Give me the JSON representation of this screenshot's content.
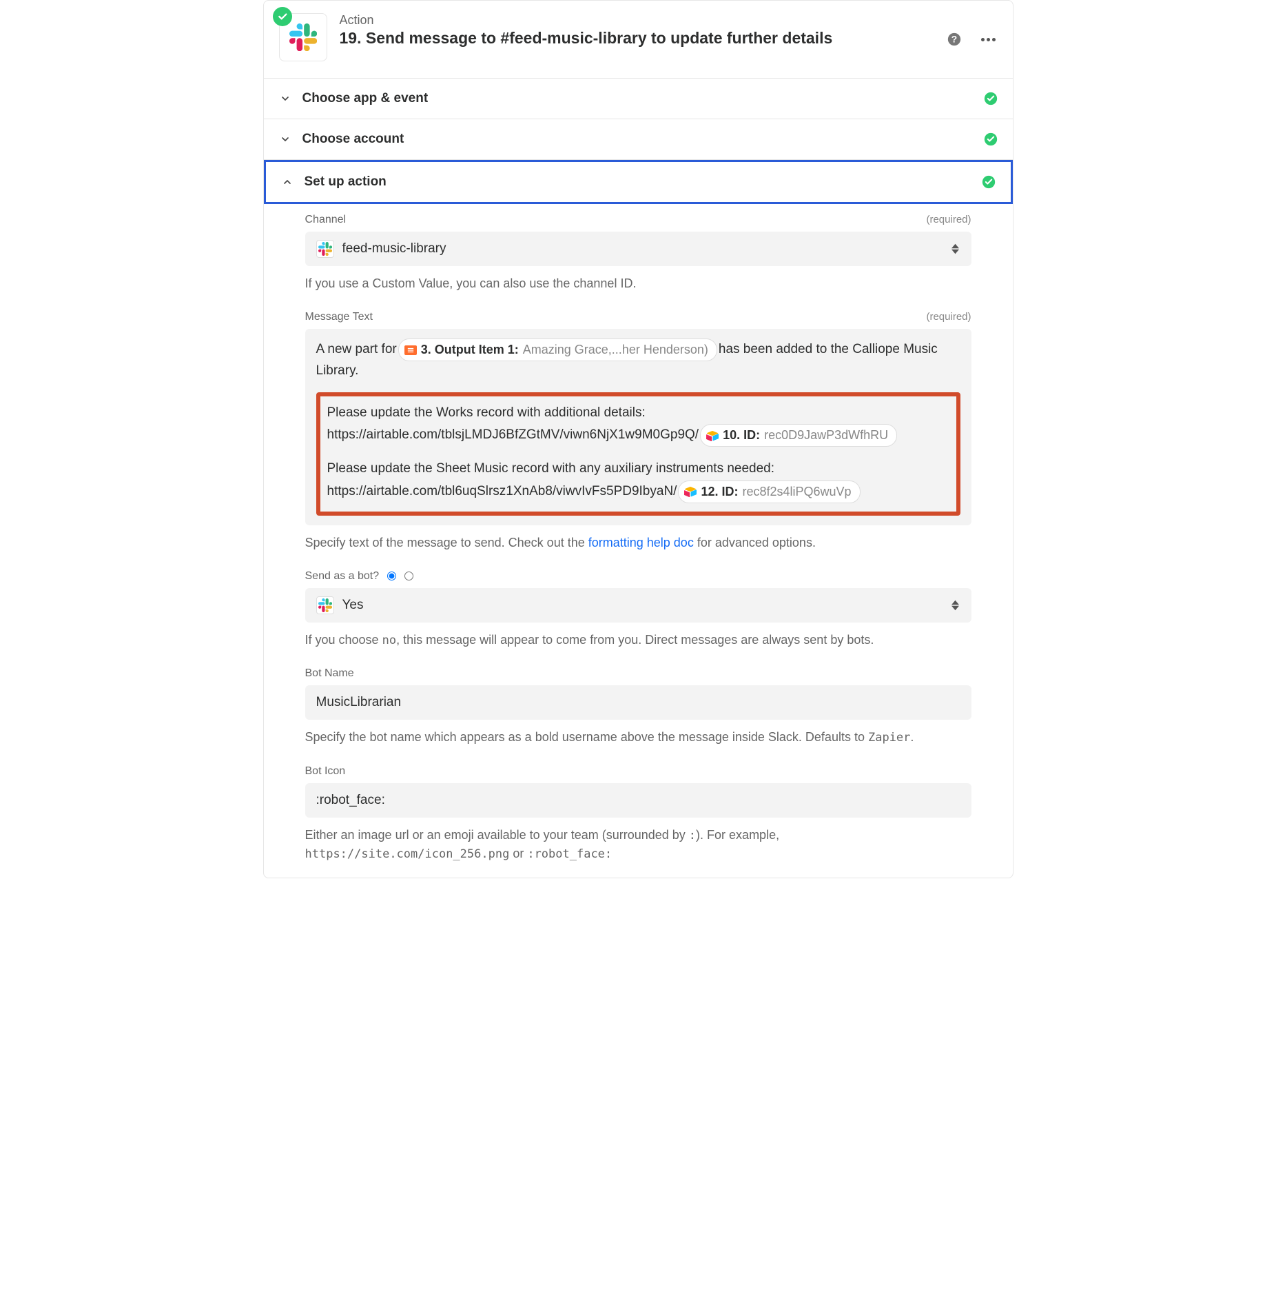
{
  "header": {
    "label": "Action",
    "title": "19. Send message to #feed-music-library to update further details"
  },
  "sections": {
    "chooseApp": "Choose app & event",
    "chooseAccount": "Choose account",
    "setUpAction": "Set up action"
  },
  "fields": {
    "channel": {
      "label": "Channel",
      "required": "(required)",
      "value": "feed-music-library",
      "help": "If you use a Custom Value, you can also use the channel ID."
    },
    "messageText": {
      "label": "Message Text",
      "required": "(required)",
      "line1_prefix": "A new part for ",
      "pill1_bold": "3. Output Item 1: ",
      "pill1_muted": "Amazing Grace,...her Henderson)",
      "line1_suffix": " has been added to the Calliope Music",
      "line2": "Library.",
      "block1_line1": "Please update the Works record with additional details:",
      "block1_url": "https://airtable.com/tblsjLMDJ6BfZGtMV/viwn6NjX1w9M0Gp9Q/",
      "block1_pill_bold": "10. ID: ",
      "block1_pill_muted": "rec0D9JawP3dWfhRU",
      "block2_line1": "Please update the Sheet Music record with any auxiliary instruments needed:",
      "block2_url": "https://airtable.com/tbl6uqSlrsz1XnAb8/viwvIvFs5PD9IbyaN/",
      "block2_pill_bold": "12. ID: ",
      "block2_pill_muted": "rec8f2s4liPQ6wuVp",
      "help_prefix": "Specify text of the message to send. Check out the ",
      "help_link": "formatting help doc",
      "help_suffix": " for advanced options."
    },
    "sendAsBot": {
      "label": "Send as a bot?",
      "value": "Yes",
      "help_prefix": "If you choose ",
      "help_code": "no",
      "help_suffix": ", this message will appear to come from you. Direct messages are always sent by bots."
    },
    "botName": {
      "label": "Bot Name",
      "value": "MusicLibrarian",
      "help_prefix": "Specify the bot name which appears as a bold username above the message inside Slack. Defaults to ",
      "help_code": "Zapier",
      "help_suffix": "."
    },
    "botIcon": {
      "label": "Bot Icon",
      "value": ":robot_face:",
      "help_prefix": "Either an image url or an emoji available to your team (surrounded by ",
      "help_code1": ":",
      "help_mid": "). For example, ",
      "help_code2": "https://site.com/icon_256.png",
      "help_or": " or ",
      "help_code3": ":robot_face:"
    }
  }
}
